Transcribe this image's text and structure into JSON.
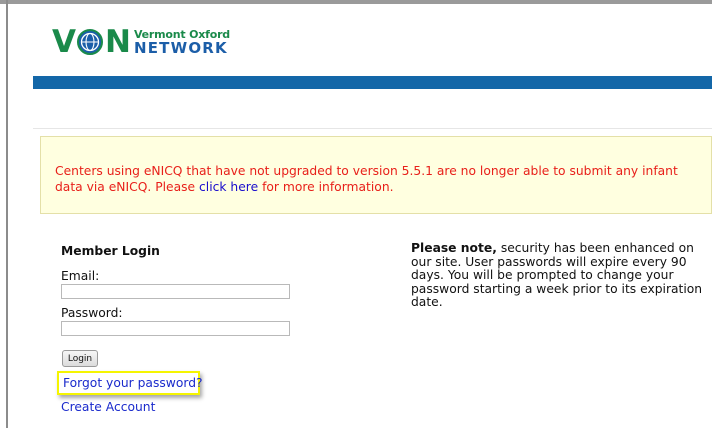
{
  "logo": {
    "mark_v": "V",
    "mark_n": "N",
    "line1": "Vermont Oxford",
    "line2": "NETWORK",
    "colors": {
      "green": "#1a8a4a",
      "blue": "#1c5ea8"
    }
  },
  "nav_bar_color": "#1367a8",
  "notice": {
    "text_before": "Centers using eNICQ that have not upgraded to version 5.5.1 are no longer able to submit any infant data via eNICQ. Please ",
    "link_text": "click here",
    "text_after": " for more information.",
    "color": "#e8201a"
  },
  "login": {
    "title": "Member Login",
    "email_label": "Email:",
    "email_value": "",
    "password_label": "Password:",
    "password_value": "",
    "button_label": "Login",
    "forgot_link": "Forgot your password?",
    "create_link": "Create Account"
  },
  "note": {
    "bold": "Please note,",
    "text": " security has been enhanced on our site. User passwords will expire every 90 days. You will be prompted to change your password starting a week prior to its expiration date."
  }
}
